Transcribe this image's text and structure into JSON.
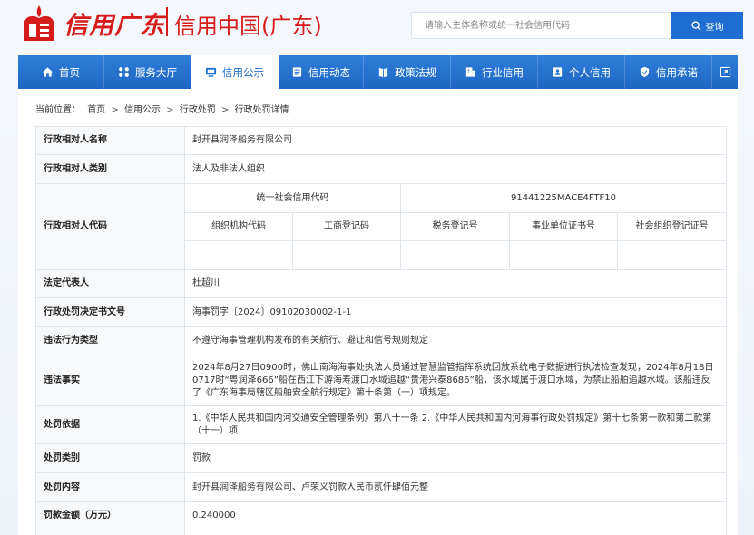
{
  "header": {
    "logo_script": "信用广东",
    "logo_text": "信用中国(广东)",
    "search_placeholder": "请输入主体名称或统一社会信用代码",
    "search_button": "查询"
  },
  "nav": {
    "items": [
      {
        "label": "首页",
        "icon": "home-icon"
      },
      {
        "label": "服务大厅",
        "icon": "grid-icon"
      },
      {
        "label": "信用公示",
        "icon": "monitor-icon"
      },
      {
        "label": "信用动态",
        "icon": "news-icon"
      },
      {
        "label": "政策法规",
        "icon": "book-icon"
      },
      {
        "label": "行业信用",
        "icon": "building-icon"
      },
      {
        "label": "个人信用",
        "icon": "id-card-icon"
      },
      {
        "label": "信用承诺",
        "icon": "shield-icon"
      }
    ],
    "active_index": 2
  },
  "breadcrumb": {
    "prefix": "当前位置：",
    "items": [
      "首页",
      "信用公示",
      "行政处罚",
      "行政处罚详情"
    ],
    "separator": ">"
  },
  "detail": {
    "name_label": "行政相对人名称",
    "name_value": "封开县润泽船务有限公司",
    "category_label": "行政相对人类别",
    "category_value": "法人及非法人组织",
    "code_label": "行政相对人代码",
    "uscc_label": "统一社会信用代码",
    "uscc_value": "91441225MACE4FTF10",
    "sub_labels": [
      "组织机构代码",
      "工商登记码",
      "税务登记号",
      "事业单位证书号",
      "社会组织登记证号"
    ],
    "sub_values": [
      "",
      "",
      "",
      "",
      ""
    ],
    "legal_rep_label": "法定代表人",
    "legal_rep_value": "杜超川",
    "doc_no_label": "行政处罚决定书文号",
    "doc_no_value": "海事罚字〔2024〕09102030002-1-1",
    "violation_type_label": "违法行为类型",
    "violation_type_value": "不遵守海事管理机构发布的有关航行、避让和信号规则规定",
    "facts_label": "违法事实",
    "facts_value": "2024年8月27日0900时，佛山南海海事处执法人员通过智慧监管指挥系统回放系统电子数据进行执法检查发现，2024年8月18日0717时“粤润泽666”船在西江下游海寿渡口水域追越“贵港兴泰8686”船，该水域属于渡口水域，为禁止船舶追越水域。该船违反了《广东海事局辖区船舶安全航行规定》第十条第（一）项规定。",
    "basis_label": "处罚依据",
    "basis_value": "1.《中华人民共和国内河交通安全管理条例》第八十一条 2.《中华人民共和国内河海事行政处罚规定》第十七条第一款和第二款第（十一）项",
    "penalty_type_label": "处罚类别",
    "penalty_type_value": "罚款",
    "penalty_content_label": "处罚内容",
    "penalty_content_value": "封开县润泽船务有限公司、卢荣义罚款人民币贰仟肆佰元整",
    "amount_label": "罚款金额（万元）",
    "amount_value": "0.240000"
  },
  "colors": {
    "brand_red": "#d61b1b",
    "nav_blue": "#1e6fd1",
    "label_bg": "#f7f8fa",
    "border": "#dfe5ec"
  }
}
